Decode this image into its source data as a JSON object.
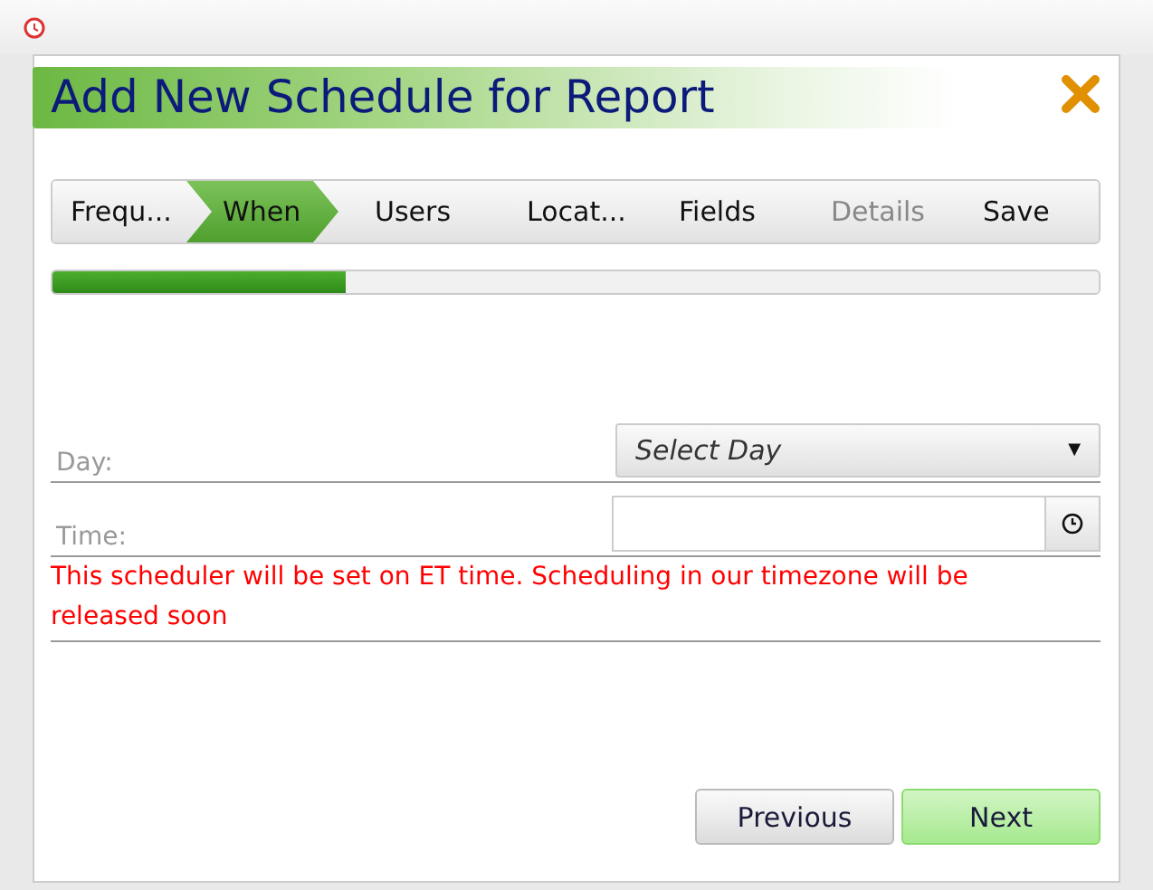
{
  "dialog": {
    "title": "Add New Schedule for Report"
  },
  "steps": [
    {
      "label": "Frequ...",
      "selected": false,
      "disabled": false
    },
    {
      "label": "When",
      "selected": true,
      "disabled": false
    },
    {
      "label": "Users",
      "selected": false,
      "disabled": false
    },
    {
      "label": "Locat...",
      "selected": false,
      "disabled": false
    },
    {
      "label": "Fields",
      "selected": false,
      "disabled": false
    },
    {
      "label": "Details",
      "selected": false,
      "disabled": true
    },
    {
      "label": "Save",
      "selected": false,
      "disabled": false
    }
  ],
  "progress": {
    "level": 0.28
  },
  "form": {
    "day_label": "Day:",
    "day_select": "Select Day",
    "day_caret": "▼",
    "time_label": "Time:",
    "notice": "This scheduler will be set on ET time. Scheduling in our timezone will be released soon"
  },
  "buttons": [
    {
      "label": "Previous",
      "kind": "secondary"
    },
    {
      "label": "Next",
      "kind": "primary"
    }
  ]
}
